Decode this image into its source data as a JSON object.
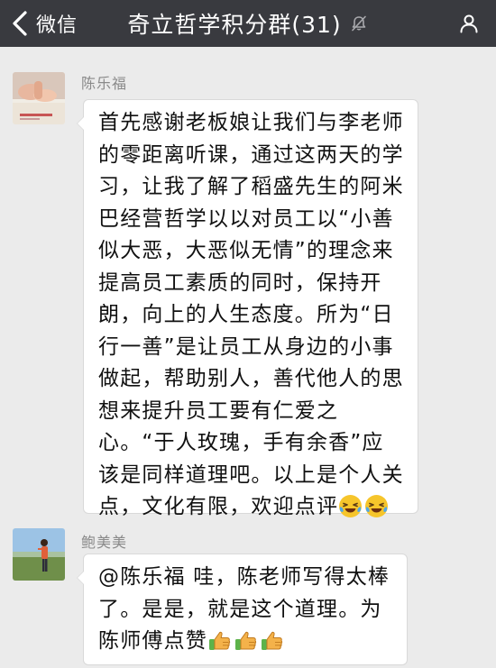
{
  "navbar": {
    "back_label": "微信",
    "title": "奇立哲学积分群(31)",
    "back_icon": "chevron-left-icon",
    "mute_icon": "bell-muted-icon",
    "more_icon": "people-icon"
  },
  "messages": [
    {
      "sender": "陈乐福",
      "text": "首先感谢老板娘让我们与李老师的零距离听课，通过这两天的学习，让我了解了稻盛先生的阿米巴经营哲学以以对员工以“小善似大恶，大恶似无情”的理念来提高员工素质的同时，保持开朗，向上的人生态度。所为“日行一善”是让员工从身边的小事做起，帮助别人，善代他人的思想来提升员工要有仁爱之心。“于人玫瑰，手有余香”应该是同样道理吧。以上是个人关点，文化有限，欢迎点评",
      "emojis": [
        "laughing-tears-emoji",
        "laughing-tears-emoji"
      ]
    },
    {
      "sender": "鲍美美",
      "text": "@陈乐福 哇，陈老师写得太棒了。是是，就是这个道理。为陈师傅点赞",
      "emojis": [
        "thumbs-up-emoji",
        "thumbs-up-emoji",
        "thumbs-up-emoji"
      ]
    }
  ],
  "colors": {
    "navbar_bg": "#393a3f",
    "chat_bg": "#ebebeb",
    "bubble_bg": "#ffffff",
    "emoji_yellow": "#f6c52b",
    "thumb_color": "#f4b24a",
    "cuff_green": "#5db34a"
  }
}
